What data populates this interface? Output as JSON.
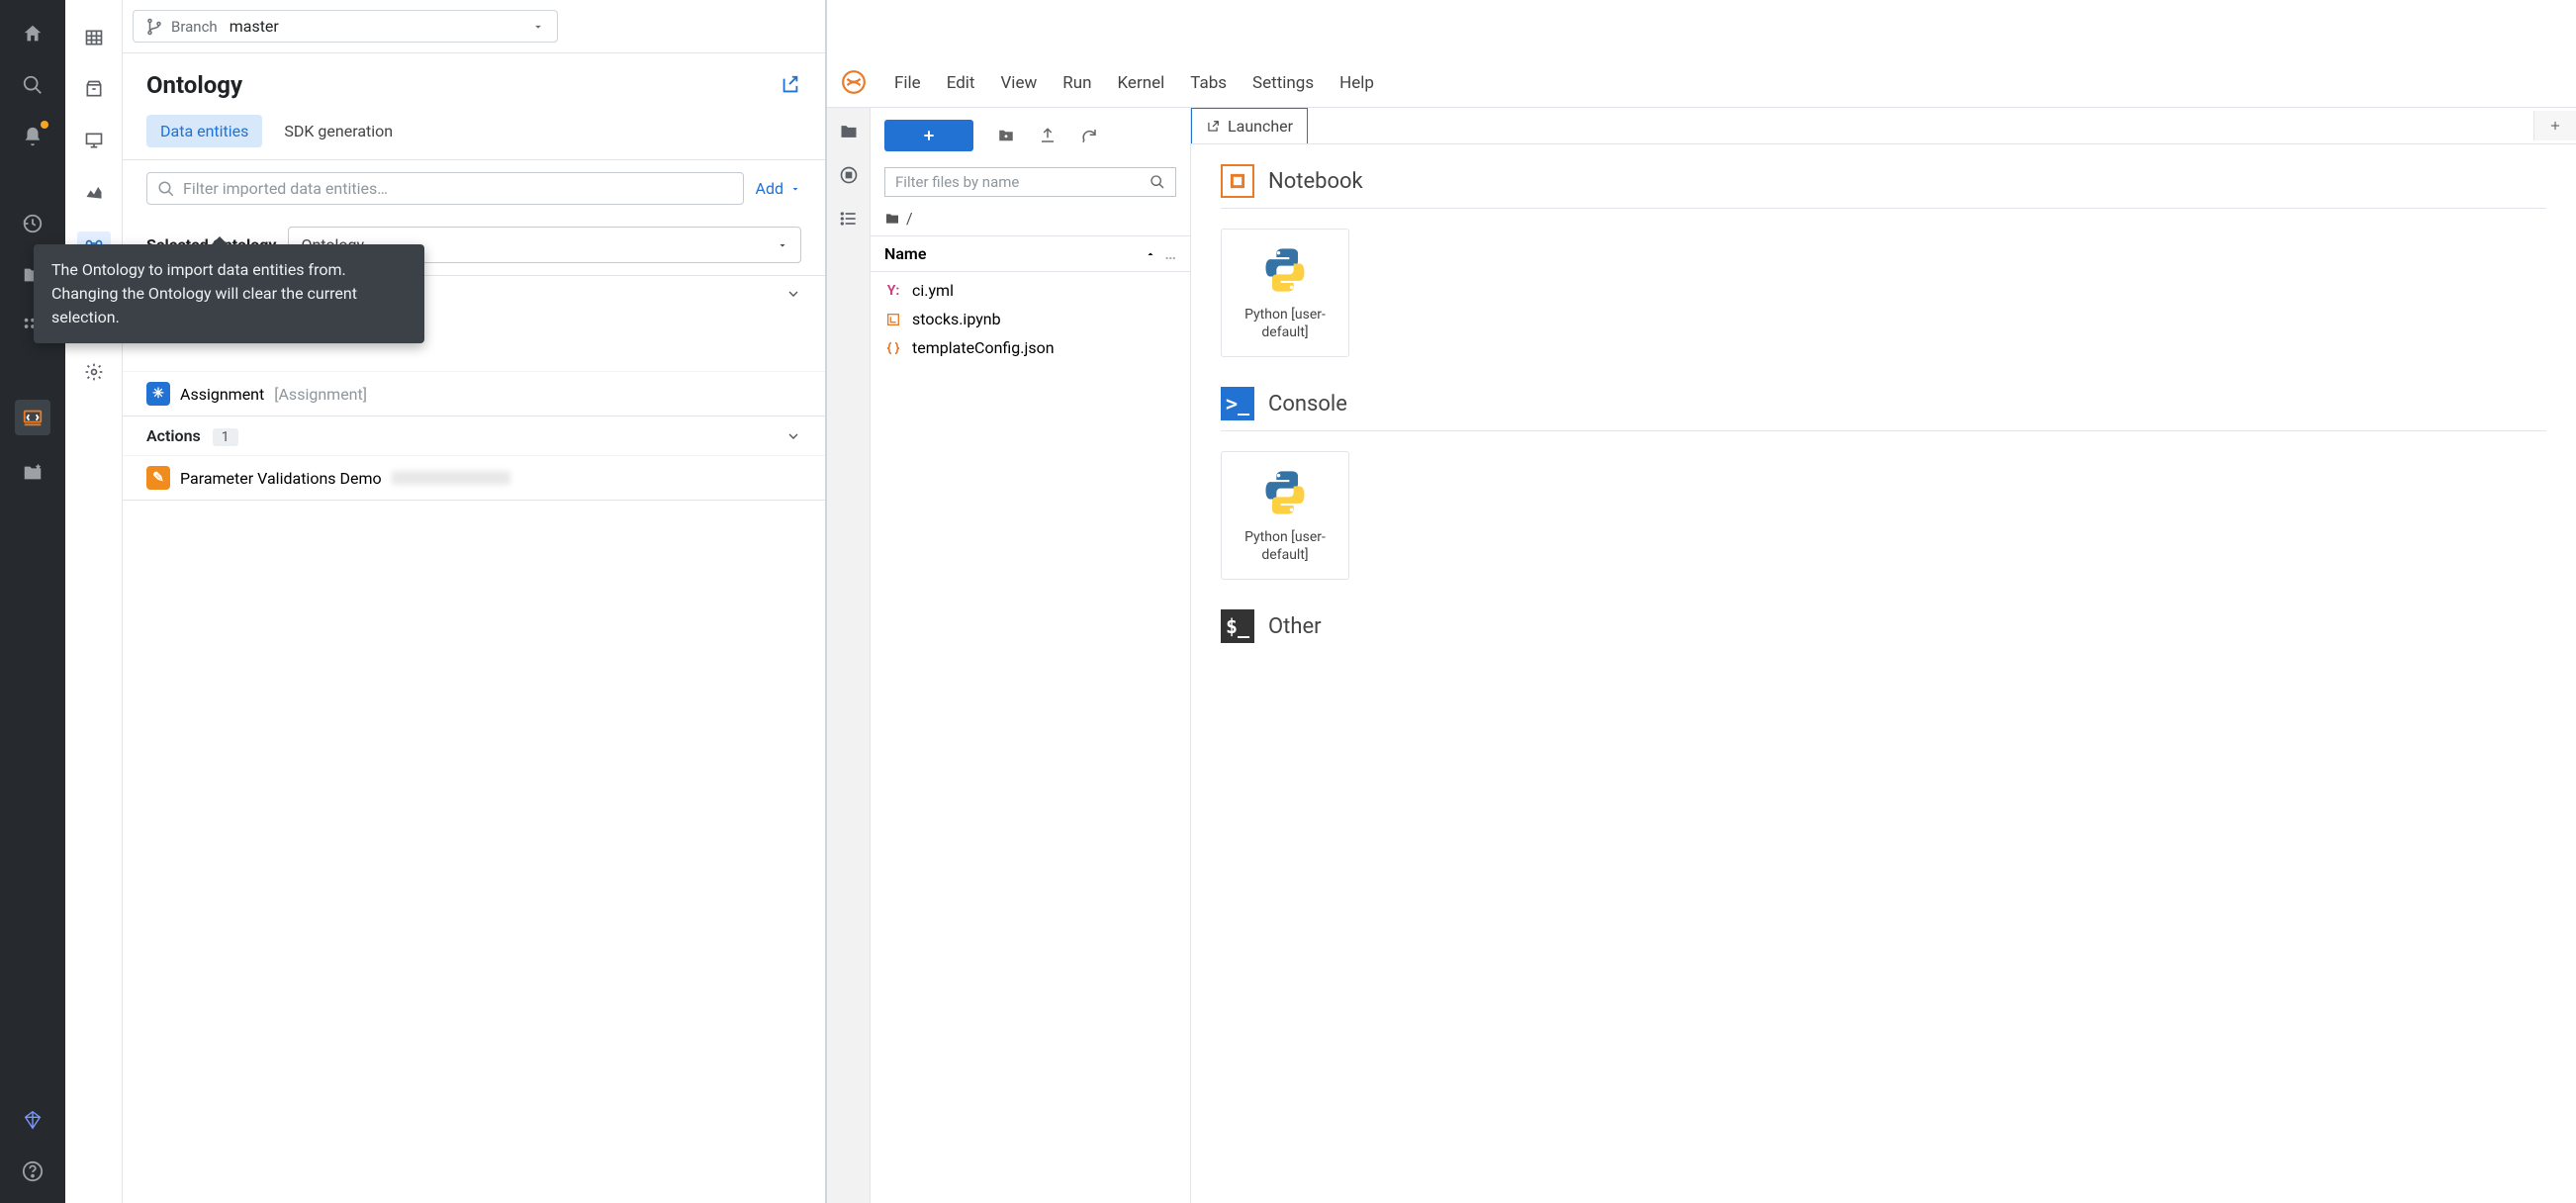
{
  "branch": {
    "label": "Branch",
    "value": "master"
  },
  "ontology": {
    "title": "Ontology",
    "tabs": [
      {
        "label": "Data entities",
        "active": true
      },
      {
        "label": "SDK generation",
        "active": false
      }
    ],
    "search_placeholder": "Filter imported data entities…",
    "add_label": "Add",
    "selected_label": "Selected Ontology",
    "selected_value": "Ontology",
    "tooltip": "The Ontology to import data entities from. Changing the Ontology will clear the current selection.",
    "groups": [
      {
        "collapsed": true
      },
      {
        "items": [
          {
            "name": "Assignment",
            "subtext": "[Assignment]",
            "badge": "blue",
            "glyph": "✳"
          }
        ]
      }
    ],
    "actions": {
      "title": "Actions",
      "count": "1",
      "items": [
        {
          "name": "Parameter Validations Demo",
          "badge": "orange",
          "glyph": "✎"
        }
      ]
    }
  },
  "jupyter": {
    "menu": [
      "File",
      "Edit",
      "View",
      "Run",
      "Kernel",
      "Tabs",
      "Settings",
      "Help"
    ],
    "filter_placeholder": "Filter files by name",
    "path": "/",
    "name_col": "Name",
    "files": [
      {
        "name": "ci.yml",
        "type": "yaml"
      },
      {
        "name": "stocks.ipynb",
        "type": "nb"
      },
      {
        "name": "templateConfig.json",
        "type": "json"
      }
    ],
    "launcher_tab": "Launcher",
    "sections": [
      {
        "title": "Notebook",
        "icon": "notebook",
        "cards": [
          {
            "label": "Python [user-default]"
          }
        ]
      },
      {
        "title": "Console",
        "icon": "console",
        "cards": [
          {
            "label": "Python [user-default]"
          }
        ]
      },
      {
        "title": "Other",
        "icon": "other",
        "cards": []
      }
    ]
  }
}
